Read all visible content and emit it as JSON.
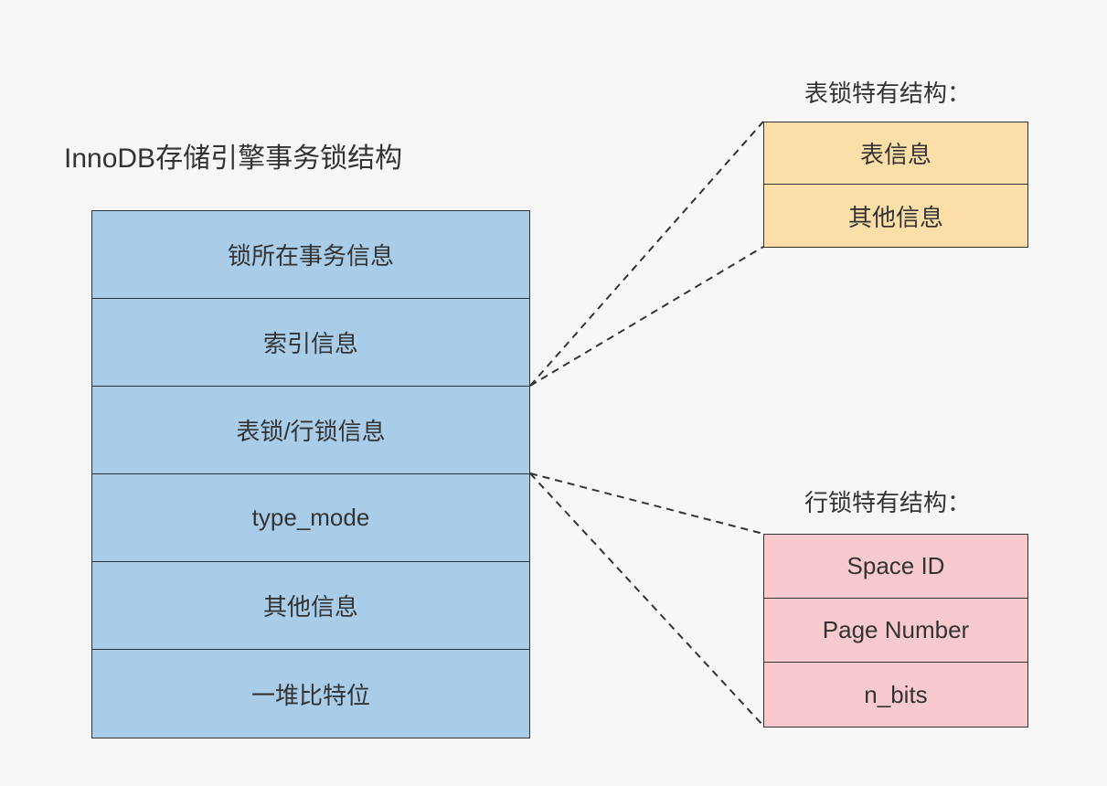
{
  "titles": {
    "main": "InnoDB存储引擎事务锁结构",
    "tableLock": "表锁特有结构：",
    "rowLock": "行锁特有结构："
  },
  "mainBox": {
    "rows": [
      "锁所在事务信息",
      "索引信息",
      "表锁/行锁信息",
      "type_mode",
      "其他信息",
      "一堆比特位"
    ]
  },
  "tableBox": {
    "rows": [
      "表信息",
      "其他信息"
    ]
  },
  "rowBox": {
    "rows": [
      "Space ID",
      "Page Number",
      "n_bits"
    ]
  },
  "colors": {
    "background": "#f7f7f7",
    "mainFill": "#a9cce8",
    "tableFill": "#fcdfa8",
    "rowFill": "#f8c9cf",
    "border": "#333333"
  }
}
